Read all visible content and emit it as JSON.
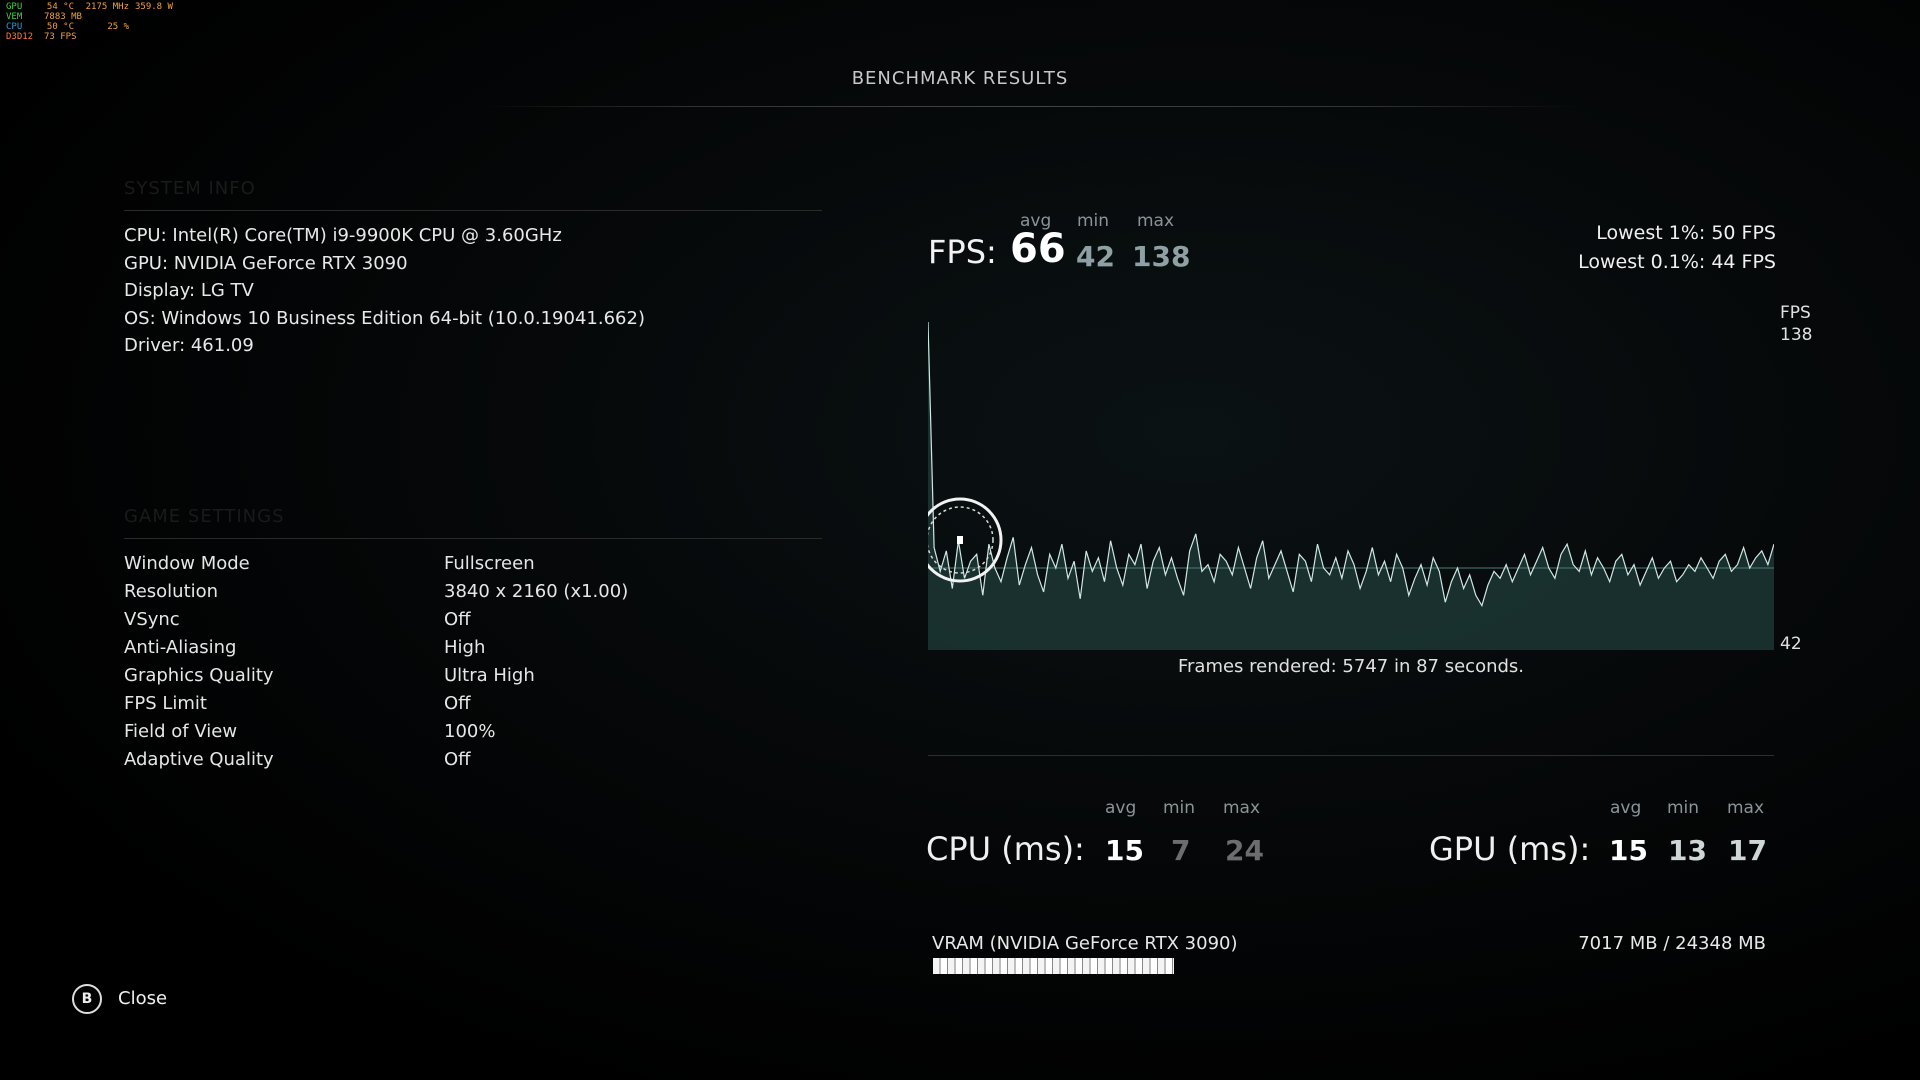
{
  "overlay": {
    "rows": [
      {
        "label": "GPU",
        "color": "#3fd34a",
        "v1": "54",
        "u1": "°C",
        "v2": "2175",
        "u2": "MHz",
        "v3": "359.8",
        "u3": "W"
      },
      {
        "label": "VEM",
        "color": "#3fd34a",
        "v1": "7883",
        "u1": "MB",
        "v2": "",
        "u2": "",
        "v3": "",
        "u3": ""
      },
      {
        "label": "CPU",
        "color": "#2a9bd8",
        "v1": "50",
        "u1": "°C",
        "v2": "25",
        "u2": "%",
        "v3": "",
        "u3": ""
      },
      {
        "label": "D3D12",
        "color": "#ff7a3a",
        "v1": "73",
        "u1": "FPS",
        "v2": "",
        "u2": "",
        "v3": "",
        "u3": ""
      }
    ]
  },
  "title": "BENCHMARK RESULTS",
  "system_info": {
    "heading": "SYSTEM INFO",
    "lines": [
      "CPU: Intel(R) Core(TM) i9-9900K CPU @ 3.60GHz",
      "GPU: NVIDIA GeForce RTX 3090",
      "Display: LG TV",
      "OS: Windows 10 Business Edition 64-bit (10.0.19041.662)",
      "Driver: 461.09"
    ]
  },
  "game_settings": {
    "heading": "GAME SETTINGS",
    "rows": [
      {
        "key": "Window Mode",
        "value": "Fullscreen"
      },
      {
        "key": "Resolution",
        "value": "3840 x 2160 (x1.00)"
      },
      {
        "key": "VSync",
        "value": "Off"
      },
      {
        "key": "Anti-Aliasing",
        "value": "High"
      },
      {
        "key": "Graphics Quality",
        "value": "Ultra High"
      },
      {
        "key": "FPS Limit",
        "value": "Off"
      },
      {
        "key": "Field of View",
        "value": "100%"
      },
      {
        "key": "Adaptive Quality",
        "value": "Off"
      }
    ]
  },
  "fps": {
    "label": "FPS:",
    "avg_label": "avg",
    "min_label": "min",
    "max_label": "max",
    "avg": "66",
    "min": "42",
    "max": "138",
    "lowest_1": "Lowest 1%: 50 FPS",
    "lowest_01": "Lowest 0.1%: 44 FPS",
    "axis_unit": "FPS",
    "axis_top": "138",
    "axis_bottom": "42",
    "frames_rendered": "Frames rendered: 5747 in 87 seconds."
  },
  "chart_data": {
    "type": "line",
    "ylim": [
      42,
      138
    ],
    "duration_s": 87,
    "avg_line": 66,
    "series": [
      {
        "values": [
          138,
          72,
          65,
          71,
          60,
          74,
          63,
          68,
          70,
          58,
          73,
          66,
          62,
          69,
          75,
          61,
          67,
          72,
          64,
          59,
          70,
          66,
          73,
          63,
          68,
          57,
          71,
          65,
          69,
          62,
          74,
          66,
          61,
          70,
          67,
          73,
          60,
          68,
          72,
          64,
          69,
          63,
          58,
          71,
          76,
          65,
          67,
          62,
          70,
          68,
          64,
          72,
          66,
          60,
          69,
          74,
          63,
          67,
          71,
          65,
          59,
          70,
          68,
          62,
          73,
          66,
          64,
          69,
          63,
          71,
          67,
          60,
          65,
          72,
          64,
          68,
          62,
          70,
          66,
          58,
          63,
          67,
          61,
          69,
          65,
          56,
          62,
          66,
          60,
          64,
          58,
          55,
          61,
          65,
          63,
          67,
          62,
          66,
          70,
          64,
          68,
          72,
          66,
          63,
          70,
          73,
          67,
          65,
          71,
          64,
          69,
          66,
          62,
          68,
          70,
          64,
          67,
          61,
          65,
          69,
          63,
          66,
          68,
          62,
          64,
          67,
          65,
          69,
          66,
          63,
          68,
          70,
          65,
          67,
          72,
          66,
          69,
          71,
          67,
          73
        ]
      }
    ]
  },
  "cpu": {
    "label": "CPU (ms):",
    "avg_label": "avg",
    "min_label": "min",
    "max_label": "max",
    "avg": "15",
    "min": "7",
    "max": "24"
  },
  "gpu": {
    "label": "GPU (ms):",
    "avg_label": "avg",
    "min_label": "min",
    "max_label": "max",
    "avg": "15",
    "min": "13",
    "max": "17"
  },
  "vram": {
    "label": "VRAM (NVIDIA GeForce RTX 3090)",
    "value": "7017 MB / 24348 MB",
    "fraction": 0.288
  },
  "close": {
    "button": "B",
    "label": "Close"
  }
}
